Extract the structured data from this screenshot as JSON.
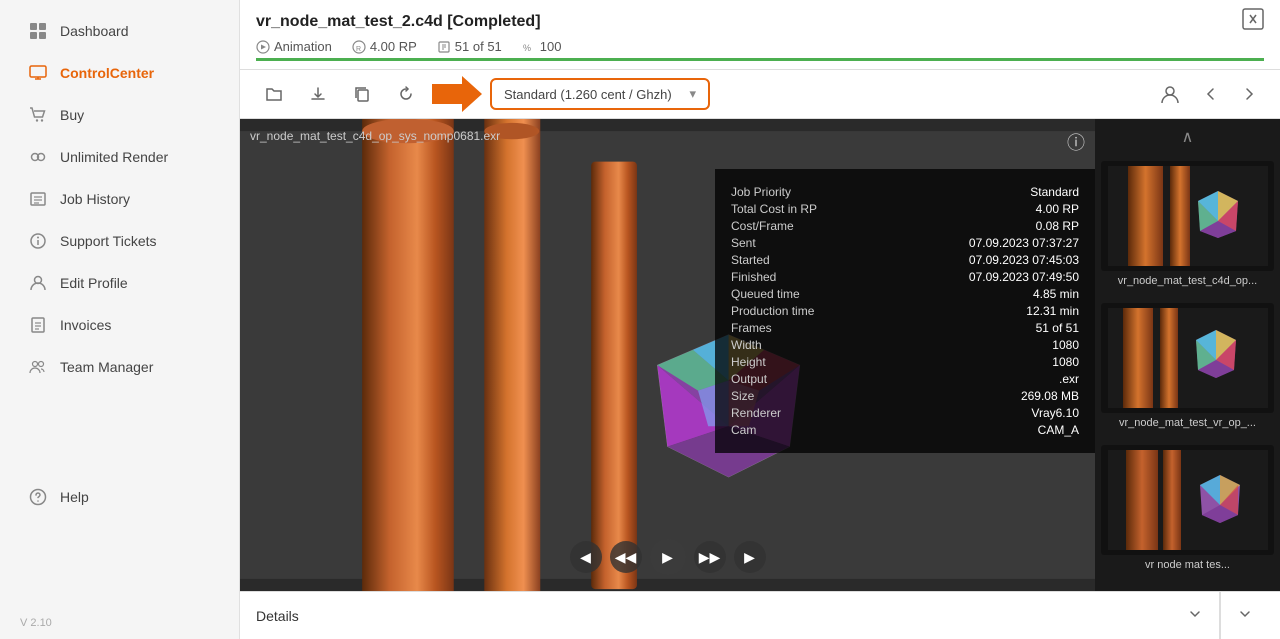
{
  "sidebar": {
    "items": [
      {
        "id": "dashboard",
        "label": "Dashboard",
        "icon": "grid-icon",
        "active": false
      },
      {
        "id": "controlcenter",
        "label": "ControlCenter",
        "icon": "monitor-icon",
        "active": true
      },
      {
        "id": "buy",
        "label": "Buy",
        "icon": "cart-icon",
        "active": false
      },
      {
        "id": "unlimited",
        "label": "Unlimited Render",
        "icon": "infinity-icon",
        "active": false
      },
      {
        "id": "jobhistory",
        "label": "Job History",
        "icon": "history-icon",
        "active": false
      },
      {
        "id": "tickets",
        "label": "Support Tickets",
        "icon": "ticket-icon",
        "active": false
      },
      {
        "id": "editprofile",
        "label": "Edit Profile",
        "icon": "user-icon",
        "active": false
      },
      {
        "id": "invoices",
        "label": "Invoices",
        "icon": "invoice-icon",
        "active": false
      },
      {
        "id": "team",
        "label": "Team Manager",
        "icon": "team-icon",
        "active": false
      },
      {
        "id": "help",
        "label": "Help",
        "icon": "help-icon",
        "active": false
      }
    ],
    "version": "V 2.10"
  },
  "header": {
    "title": "vr_node_mat_test_2.c4d [Completed]",
    "animation_label": "Animation",
    "rp_label": "4.00 RP",
    "frames_label": "51 of 51",
    "progress_label": "100",
    "progress_percent": 100,
    "exit_icon": "exit-icon"
  },
  "toolbar": {
    "folder_btn": "folder-icon",
    "download_btn": "download-icon",
    "copy_btn": "copy-icon",
    "refresh_btn": "refresh-icon",
    "send_btn": "send-icon",
    "dropdown_label": "Standard (1.260 cent / Ghzh)",
    "person_btn": "person-icon",
    "prev_btn": "chevron-left-icon",
    "next_btn": "chevron-right-icon"
  },
  "viewer": {
    "filename": "vr_node_mat_test_c4d_op_sys_nomp0681.exr",
    "info_icon": "info-icon",
    "info": {
      "rows": [
        {
          "label": "Job Priority",
          "value": "Standard"
        },
        {
          "label": "Total Cost in RP",
          "value": "4.00 RP"
        },
        {
          "label": "Cost/Frame",
          "value": "0.08 RP"
        },
        {
          "label": "Sent",
          "value": "07.09.2023 07:37:27"
        },
        {
          "label": "Started",
          "value": "07.09.2023 07:45:03"
        },
        {
          "label": "Finished",
          "value": "07.09.2023 07:49:50"
        },
        {
          "label": "Queued time",
          "value": "4.85 min"
        },
        {
          "label": "Production time",
          "value": "12.31 min"
        },
        {
          "label": "Frames",
          "value": "51 of 51"
        },
        {
          "label": "Width",
          "value": "1080"
        },
        {
          "label": "Height",
          "value": "1080"
        },
        {
          "label": "Output",
          "value": ".exr"
        },
        {
          "label": "Size",
          "value": "269.08 MB"
        },
        {
          "label": "Renderer",
          "value": "Vray6.10"
        },
        {
          "label": "Cam",
          "value": "CAM_A"
        }
      ]
    },
    "controls": {
      "prev": "◀",
      "prev_fast": "◀◀",
      "play": "▶",
      "next_fast": "▶▶",
      "next": "▶"
    }
  },
  "right_panel": {
    "thumbnails": [
      {
        "label": "vr_node_mat_test_c4d_op..."
      },
      {
        "label": "vr_node_mat_test_vr_op_..."
      },
      {
        "label": "vr node mat tes..."
      }
    ]
  },
  "details_footer": {
    "details_label": "Details",
    "chevron_icon": "chevron-down-icon",
    "extra_chevron": "chevron-down-icon"
  }
}
